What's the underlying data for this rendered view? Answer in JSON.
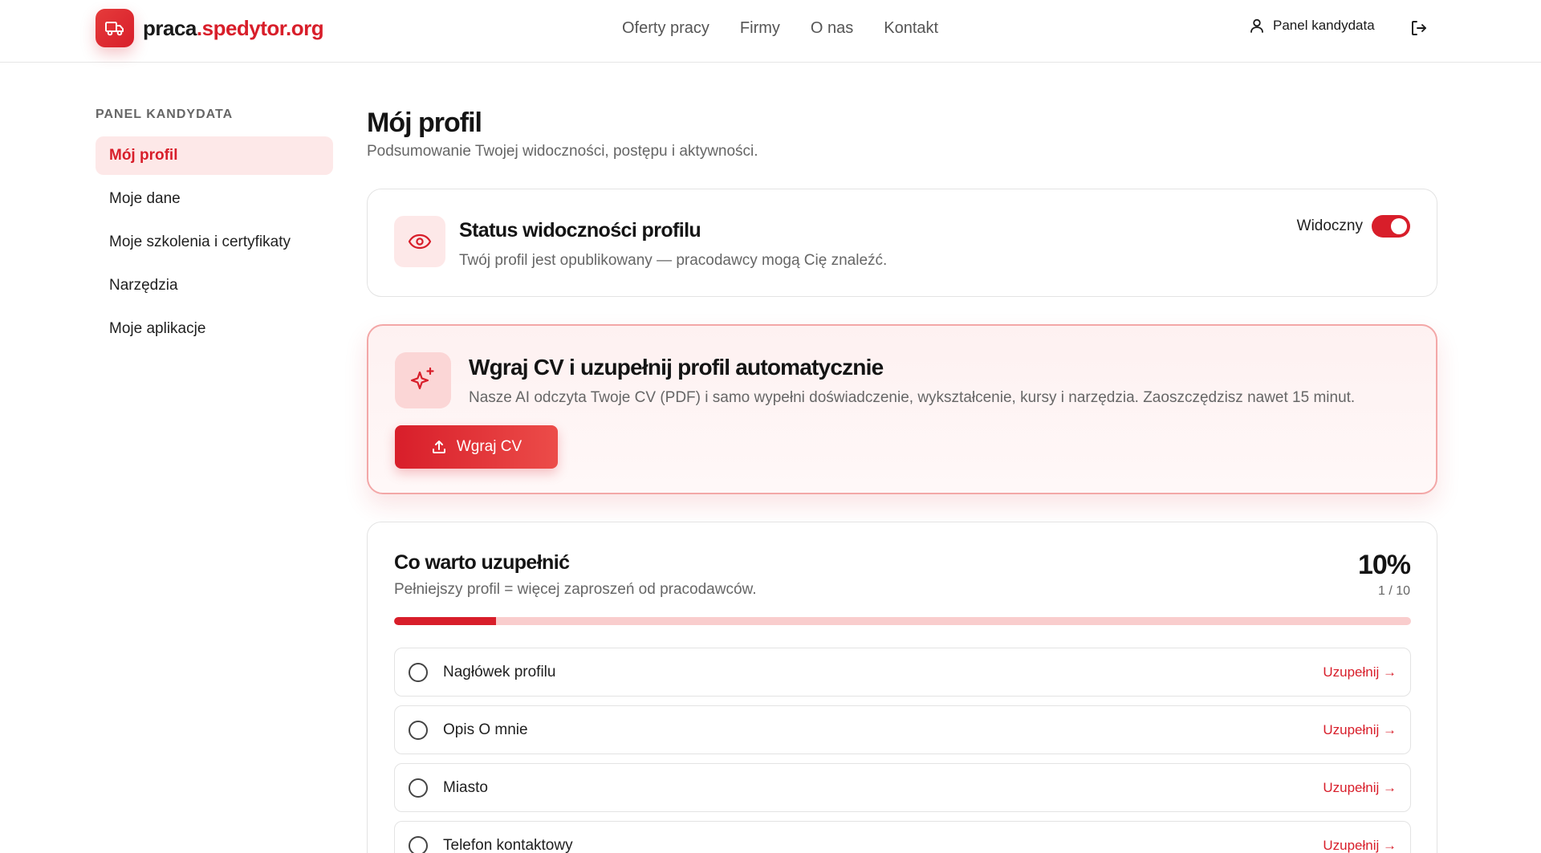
{
  "header": {
    "logo_icon": "truck-icon",
    "brand_part1": "praca",
    "brand_part2": ".spedytor.org",
    "nav": [
      {
        "label": "Oferty pracy"
      },
      {
        "label": "Firmy"
      },
      {
        "label": "O nas"
      },
      {
        "label": "Kontakt"
      }
    ],
    "panel_label": "Panel kandydata",
    "panel_icon": "user-icon",
    "logout_icon": "logout-icon"
  },
  "sidebar": {
    "heading": "PANEL KANDYDATA",
    "items": [
      {
        "label": "Mój profil",
        "active": true
      },
      {
        "label": "Moje dane"
      },
      {
        "label": "Moje szkolenia i certyfikaty"
      },
      {
        "label": "Narzędzia"
      },
      {
        "label": "Moje aplikacje"
      }
    ]
  },
  "main": {
    "title": "Mój profil",
    "subtitle": "Podsumowanie Twojej widoczności, postępu i aktywności.",
    "visibility": {
      "icon": "eye-icon",
      "title": "Status widoczności profilu",
      "description": "Twój profil jest opublikowany — pracodawcy mogą Cię znaleźć.",
      "toggle_label": "Widoczny",
      "toggle_on": true
    },
    "cv_upload": {
      "icon": "sparkles-icon",
      "title": "Wgraj CV i uzupełnij profil automatycznie",
      "description": "Nasze AI odczyta Twoje CV (PDF) i samo wypełni doświadczenie, wykształcenie, kursy i narzędzia. Zaoszczędzisz nawet 15 minut.",
      "button_label": "Wgraj CV",
      "button_icon": "upload-icon"
    },
    "completion": {
      "title": "Co warto uzupełnić",
      "subtitle": "Pełniejszy profil = więcej zaproszeń od pracodawców.",
      "percent_label": "10%",
      "count_label": "1 / 10",
      "progress": 0.1,
      "items": [
        {
          "label": "Nagłówek profilu",
          "action": "Uzupełnij →"
        },
        {
          "label": "Opis O mnie",
          "action": "Uzupełnij →"
        },
        {
          "label": "Miasto",
          "action": "Uzupełnij →"
        },
        {
          "label": "Telefon kontaktowy",
          "action": "Uzupełnij →"
        }
      ]
    }
  },
  "colors": {
    "accent": "#d81e2a",
    "accent_light": "#fde8e8"
  }
}
